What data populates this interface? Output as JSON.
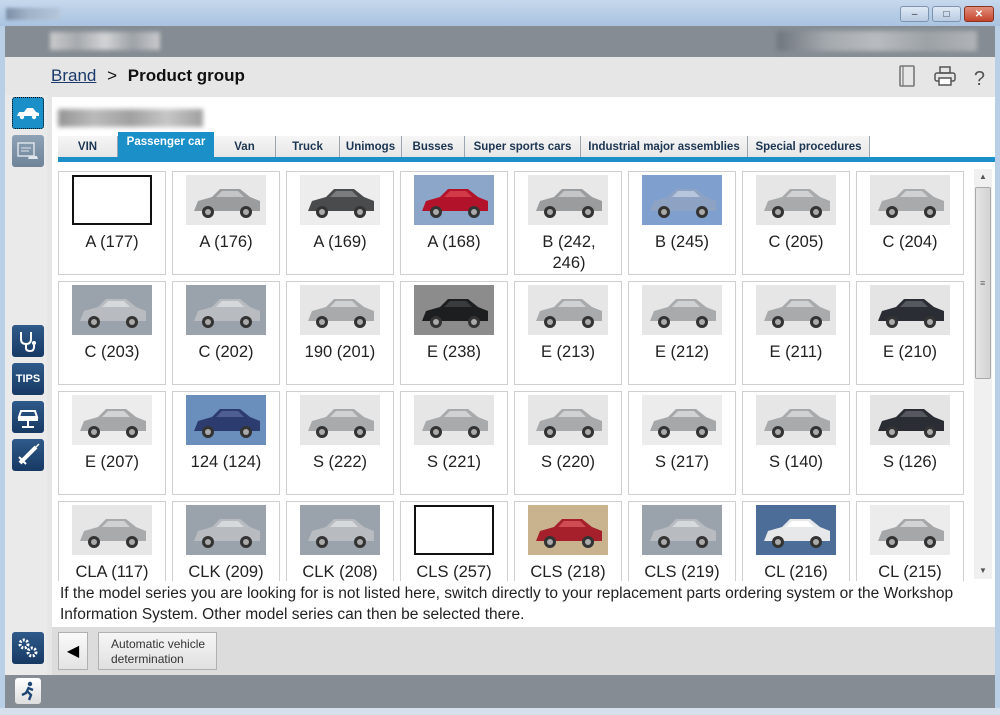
{
  "window": {
    "controls": {
      "minimize": "–",
      "maximize": "□",
      "close": "✕"
    }
  },
  "breadcrumb": {
    "parent": "Brand",
    "separator": ">",
    "current": "Product group"
  },
  "toolbar_icons": [
    "book-icon",
    "printer-icon",
    "help-icon"
  ],
  "help_label": "?",
  "sidebar": {
    "items": [
      {
        "name": "vehicle-selection",
        "icon": "car-icon",
        "active": true
      },
      {
        "name": "vehicle-data",
        "icon": "folder-car-icon",
        "active": false
      },
      {
        "name": "diagnosis",
        "icon": "stethoscope-icon",
        "active": false
      },
      {
        "name": "tips",
        "icon": "tips-icon",
        "label": "TIPS",
        "active": false
      },
      {
        "name": "vehicle-lift",
        "icon": "lift-icon",
        "active": false
      },
      {
        "name": "tools",
        "icon": "syringe-icon",
        "active": false
      },
      {
        "name": "settings",
        "icon": "gears-icon",
        "active": false
      }
    ]
  },
  "tabs": [
    {
      "label": "VIN",
      "active": false
    },
    {
      "label": "Passenger car",
      "active": true
    },
    {
      "label": "Van",
      "active": false
    },
    {
      "label": "Truck",
      "active": false
    },
    {
      "label": "Unimogs",
      "active": false
    },
    {
      "label": "Busses",
      "active": false
    },
    {
      "label": "Super sports cars",
      "active": false
    },
    {
      "label": "Industrial major assemblies",
      "active": false
    },
    {
      "label": "Special procedures",
      "active": false
    }
  ],
  "models": [
    {
      "label": "A (177)",
      "img": "empty"
    },
    {
      "label": "A (176)",
      "img": "silver-hatch"
    },
    {
      "label": "A (169)",
      "img": "dark-hatch"
    },
    {
      "label": "A (168)",
      "img": "red-hatch"
    },
    {
      "label": "B (242, 246)",
      "img": "silver-hatch"
    },
    {
      "label": "B (245)",
      "img": "blue-hatch"
    },
    {
      "label": "C (205)",
      "img": "silver-sedan"
    },
    {
      "label": "C (204)",
      "img": "silver-sedan"
    },
    {
      "label": "C (203)",
      "img": "silver-rear"
    },
    {
      "label": "C (202)",
      "img": "silver-rear"
    },
    {
      "label": "190 (201)",
      "img": "silver-sedan"
    },
    {
      "label": "E (238)",
      "img": "black-coupe"
    },
    {
      "label": "E (213)",
      "img": "silver-sedan"
    },
    {
      "label": "E (212)",
      "img": "silver-sedan"
    },
    {
      "label": "E (211)",
      "img": "silver-sedan"
    },
    {
      "label": "E (210)",
      "img": "dark-sedan"
    },
    {
      "label": "E (207)",
      "img": "silver-coupe"
    },
    {
      "label": "124 (124)",
      "img": "blue-sedan"
    },
    {
      "label": "S (222)",
      "img": "silver-sedan"
    },
    {
      "label": "S (221)",
      "img": "silver-sedan"
    },
    {
      "label": "S (220)",
      "img": "silver-sedan"
    },
    {
      "label": "S (217)",
      "img": "silver-coupe"
    },
    {
      "label": "S (140)",
      "img": "silver-sedan"
    },
    {
      "label": "S (126)",
      "img": "dark-sedan"
    },
    {
      "label": "CLA (117)",
      "img": "silver-sedan"
    },
    {
      "label": "CLK (209)",
      "img": "silver-rear"
    },
    {
      "label": "CLK (208)",
      "img": "silver-rear"
    },
    {
      "label": "CLS (257)",
      "img": "empty"
    },
    {
      "label": "CLS (218)",
      "img": "red-sedan"
    },
    {
      "label": "CLS (219)",
      "img": "silver-rear"
    },
    {
      "label": "CL (216)",
      "img": "white-coupe"
    },
    {
      "label": "CL (215)",
      "img": "silver-coupe"
    }
  ],
  "info_text": "If the model series you are looking for is not listed here, switch directly to your replacement parts ordering system or the Workshop Information System. Other model series can then be selected there.",
  "bottom": {
    "back_label": "◀",
    "auto_button": "Automatic vehicle determination"
  },
  "colors": {
    "accent": "#1a8fc8",
    "sidebar_dark": "#1f4775",
    "header_band": "#858c93"
  }
}
